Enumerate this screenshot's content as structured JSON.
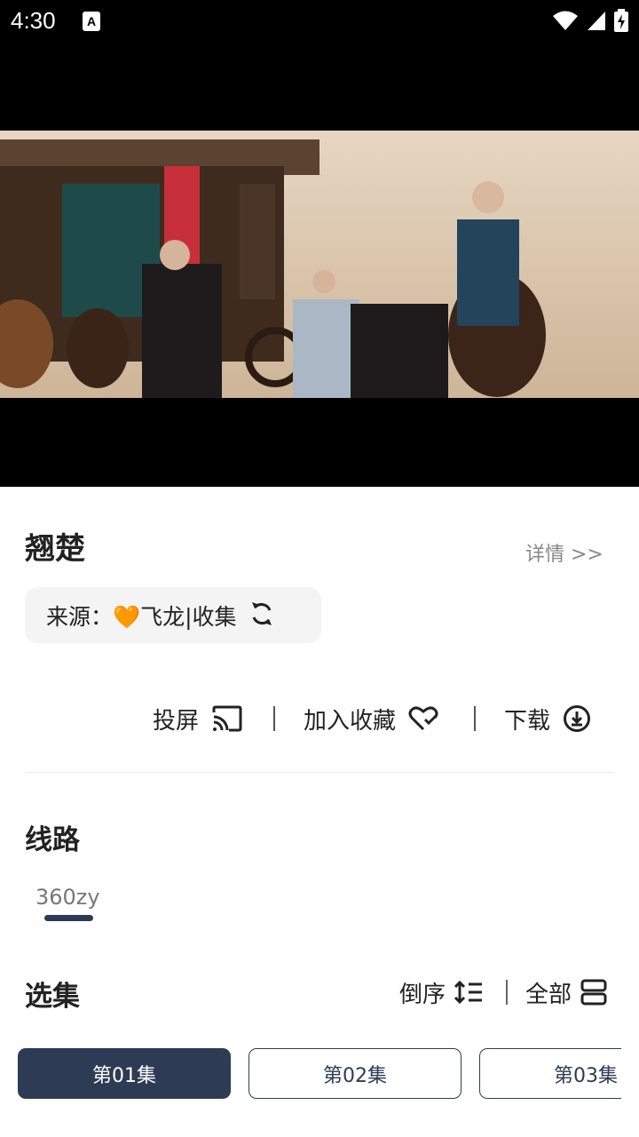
{
  "status_bar": {
    "time": "4:30",
    "notification_badge": "A"
  },
  "video": {
    "title": "翘楚"
  },
  "details_link": "详情 >>",
  "source": {
    "label": "来源：🧡飞龙|收集"
  },
  "actions": {
    "cast": "投屏",
    "favorite": "加入收藏",
    "download": "下载"
  },
  "routes": {
    "title": "线路",
    "items": [
      "360zy"
    ]
  },
  "episodes": {
    "title": "选集",
    "reverse_label": "倒序",
    "all_label": "全部",
    "items": [
      "第01集",
      "第02集",
      "第03集"
    ]
  },
  "colors": {
    "accent": "#2d3b55",
    "chip_bg": "#f4f4f4",
    "muted_text": "#888888"
  }
}
